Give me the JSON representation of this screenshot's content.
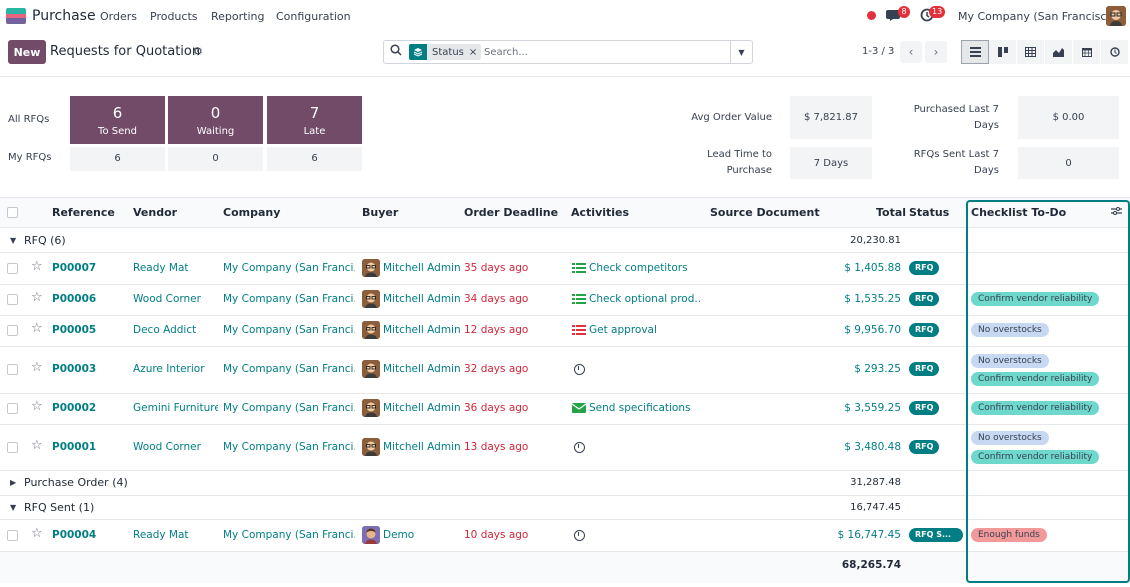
{
  "navbar": {
    "app_name": "Purchase",
    "menu": [
      "Orders",
      "Products",
      "Reporting",
      "Configuration"
    ],
    "messages_count": "8",
    "activities_count": "13",
    "company": "My Company (San Francisco)"
  },
  "control": {
    "new_label": "New",
    "breadcrumb": "Requests for Quotation",
    "facet_label": "Status",
    "search_placeholder": "Search...",
    "pager": "1-3 / 3"
  },
  "dashboard": {
    "all_rfqs_label": "All RFQs",
    "my_rfqs_label": "My RFQs",
    "tiles": [
      {
        "value": "6",
        "label": "To Send"
      },
      {
        "value": "0",
        "label": "Waiting"
      },
      {
        "value": "7",
        "label": "Late"
      }
    ],
    "my": [
      "6",
      "0",
      "6"
    ],
    "avg_order_value_label": "Avg Order Value",
    "avg_order_value": "$ 7,821.87",
    "lead_time_label_1": "Lead Time to",
    "lead_time_label_2": "Purchase",
    "lead_time": "7 Days",
    "purchased_label_1": "Purchased Last 7",
    "purchased_label_2": "Days",
    "purchased": "$ 0.00",
    "rfq_sent_label_1": "RFQs Sent Last 7",
    "rfq_sent_label_2": "Days",
    "rfq_sent": "0"
  },
  "table": {
    "headers": {
      "reference": "Reference",
      "vendor": "Vendor",
      "company": "Company",
      "buyer": "Buyer",
      "deadline": "Order Deadline",
      "activities": "Activities",
      "source": "Source Document",
      "total": "Total",
      "status": "Status",
      "checklist": "Checklist To-Do"
    },
    "groups": {
      "rfq": {
        "label": "RFQ (6)",
        "total": "20,230.81"
      },
      "po": {
        "label": "Purchase Order (4)",
        "total": "31,287.48"
      },
      "sent": {
        "label": "RFQ Sent (1)",
        "total": "16,747.45"
      }
    },
    "rows": [
      {
        "ref": "P00007",
        "vendor": "Ready Mat",
        "company": "My Company (San Franci...",
        "buyer": "Mitchell Admin",
        "deadline": "35 days ago",
        "activity": "Check competitors",
        "total": "$ 1,405.88",
        "status": "RFQ"
      },
      {
        "ref": "P00006",
        "vendor": "Wood Corner",
        "company": "My Company (San Franci...",
        "buyer": "Mitchell Admin",
        "deadline": "34 days ago",
        "activity": "Check optional prod...",
        "total": "$ 1,535.25",
        "status": "RFQ",
        "tag1": "Confirm vendor reliability"
      },
      {
        "ref": "P00005",
        "vendor": "Deco Addict",
        "company": "My Company (San Franci...",
        "buyer": "Mitchell Admin",
        "deadline": "12 days ago",
        "activity": "Get approval",
        "total": "$ 9,956.70",
        "status": "RFQ",
        "tag1": "No overstocks"
      },
      {
        "ref": "P00003",
        "vendor": "Azure Interior",
        "company": "My Company (San Franci...",
        "buyer": "Mitchell Admin",
        "deadline": "32 days ago",
        "total": "$ 293.25",
        "status": "RFQ",
        "tag1": "No overstocks",
        "tag2": "Confirm vendor reliability"
      },
      {
        "ref": "P00002",
        "vendor": "Gemini Furniture",
        "company": "My Company (San Franci...",
        "buyer": "Mitchell Admin",
        "deadline": "36 days ago",
        "activity": "Send specifications",
        "total": "$ 3,559.25",
        "status": "RFQ",
        "tag1": "Confirm vendor reliability"
      },
      {
        "ref": "P00001",
        "vendor": "Wood Corner",
        "company": "My Company (San Franci...",
        "buyer": "Mitchell Admin",
        "deadline": "13 days ago",
        "total": "$ 3,480.48",
        "status": "RFQ",
        "tag1": "No overstocks",
        "tag2": "Confirm vendor reliability"
      },
      {
        "ref": "P00004",
        "vendor": "Ready Mat",
        "company": "My Company (San Franci...",
        "buyer": "Demo",
        "deadline": "10 days ago",
        "total": "$ 16,747.45",
        "status": "RFQ S...",
        "tag1": "Enough funds"
      }
    ],
    "grand_total": "68,265.74"
  },
  "colors": {
    "brand": "#714b67",
    "link": "#017e84",
    "danger": "#d1253a"
  }
}
